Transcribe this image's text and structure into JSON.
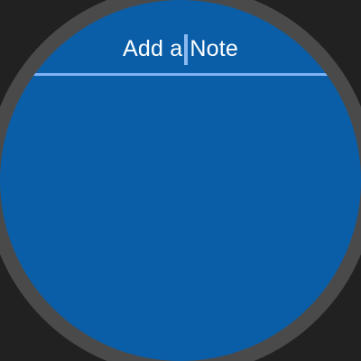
{
  "note_input": {
    "text_before_cursor": "Add a",
    "text_after_cursor": "Note"
  },
  "colors": {
    "background": "#212121",
    "bezel": "#4a4a4a",
    "watch_face": "#0a5ea8",
    "underline_accent": "#7fb3f5",
    "cursor": "#8ab8f0",
    "text": "#ffffff"
  }
}
